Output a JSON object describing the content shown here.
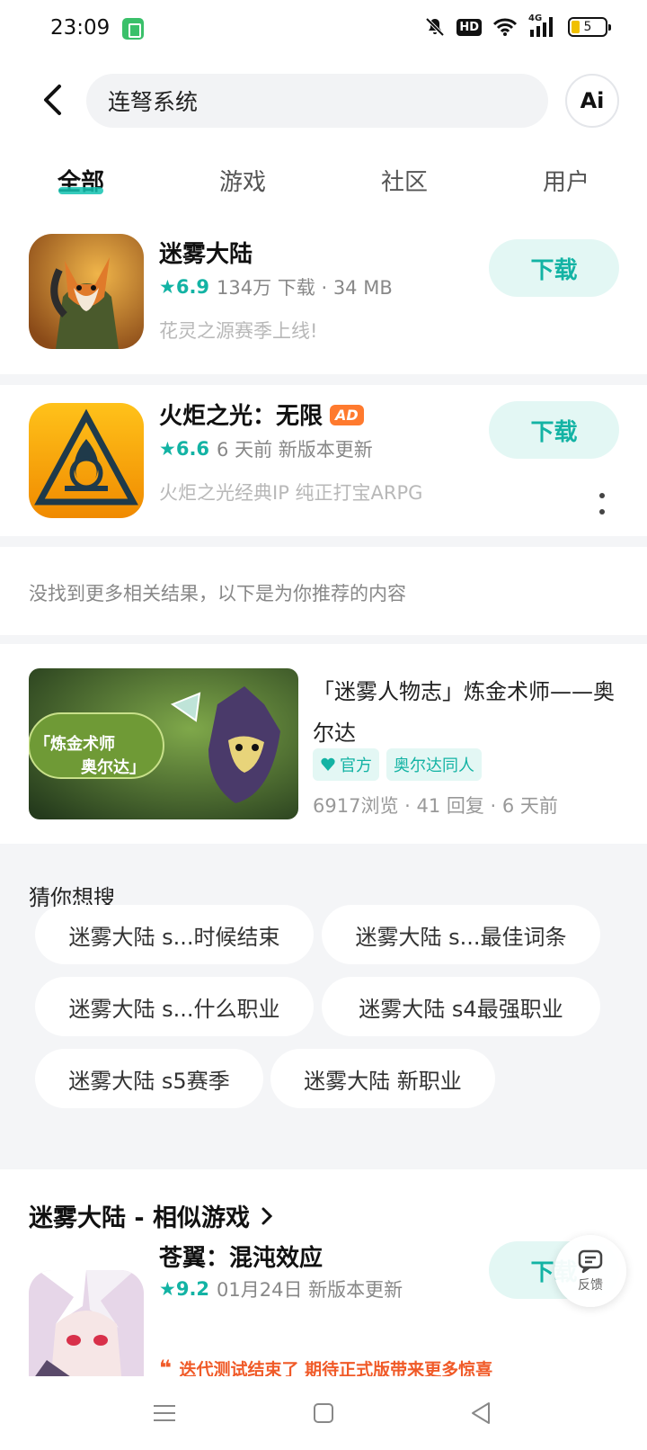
{
  "status_bar": {
    "time": "23:09",
    "battery": "5",
    "network": "4G",
    "hd": "HD"
  },
  "search": {
    "query": "连弩系统",
    "ai_label": "Ai"
  },
  "tabs": [
    {
      "label": "全部",
      "active": true
    },
    {
      "label": "游戏"
    },
    {
      "label": "社区"
    },
    {
      "label": "用户"
    }
  ],
  "results": [
    {
      "title": "迷雾大陆",
      "rating": "6.9",
      "info": "134万 下载 · 34 MB",
      "desc": "花灵之源赛季上线!",
      "button": "下载"
    },
    {
      "title": "火炬之光：无限",
      "ad_badge": "AD",
      "rating": "6.6",
      "info": "6 天前 新版本更新",
      "desc": "火炬之光经典IP  纯正打宝ARPG",
      "button": "下载"
    }
  ],
  "notice": "没找到更多相关结果，以下是为你推荐的内容",
  "post": {
    "title": "「迷雾人物志」炼金术师——奥尔达",
    "thumb_text_1": "「炼金术师",
    "thumb_text_2": "奥尔达」",
    "tags": [
      "官方",
      "奥尔达同人"
    ],
    "meta": "6917浏览 · 41 回复 · 6 天前"
  },
  "guess": {
    "title": "猜你想搜",
    "chips": [
      "迷雾大陆 s...时候结束",
      "迷雾大陆 s...最佳词条",
      "迷雾大陆 s...什么职业",
      "迷雾大陆 s4最强职业",
      "迷雾大陆 s5赛季",
      "迷雾大陆 新职业"
    ]
  },
  "similar": {
    "title": "迷雾大陆 - 相似游戏",
    "item": {
      "title": "苍翼：混沌效应",
      "rating": "9.2",
      "info": "01月24日 新版本更新",
      "quote": "迭代测试结束了 期待正式版带来更多惊喜",
      "button": "下载"
    }
  },
  "feedback": {
    "label": "反馈"
  },
  "colors": {
    "accent": "#13b3a4",
    "button_bg": "#e3f7f4",
    "ad": "#ff7a2e",
    "quote": "#f05a28"
  }
}
